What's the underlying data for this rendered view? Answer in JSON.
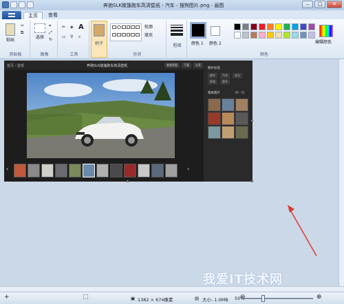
{
  "window": {
    "title": "奔驰SLK敞篷跑车高清壁纸 - 汽车 - 搜狗图片.png - 画图",
    "min_label": "–",
    "max_label": "□",
    "close_label": "✕"
  },
  "tabs": [
    {
      "label": "主页"
    },
    {
      "label": "查看"
    }
  ],
  "ribbon": {
    "clipboard": {
      "label": "剪贴板",
      "paste": "粘贴"
    },
    "image": {
      "label": "图像",
      "select": "选择"
    },
    "tools": {
      "label": "工具",
      "text_tool": "A"
    },
    "brushes": {
      "label": "刷子"
    },
    "shapes": {
      "label": "形状",
      "outline": "轮廓",
      "fill": "填充"
    },
    "size": {
      "label": "粗细"
    },
    "colors": {
      "label": "颜色",
      "color1": "颜色 1",
      "color2": "颜色 2",
      "edit": "编辑颜色",
      "palette": [
        "#000000",
        "#7f7f7f",
        "#880015",
        "#ed1c24",
        "#ff7f27",
        "#fff200",
        "#22b14c",
        "#00a2e8",
        "#3f48cc",
        "#a349a4",
        "#ffffff",
        "#c3c3c3",
        "#b97a57",
        "#ffaec9",
        "#ffc90e",
        "#efe4b0",
        "#b5e61d",
        "#99d9ea",
        "#7092be",
        "#c8bfe7"
      ]
    }
  },
  "screenshot": {
    "breadcrumb": "首页 › 壁纸",
    "title": "奔驰SLK敞篷跑车高清壁纸",
    "tools": [
      "查看原图",
      "下载",
      "分享"
    ],
    "side": {
      "sec1": "图片标签",
      "chips": [
        "跑车",
        "汽车",
        "宝马",
        "奔驰",
        "赛车"
      ],
      "sec2": "相关图片",
      "more": "换一批"
    }
  },
  "status": {
    "dimensions": "1382 × 674像素",
    "filesize": "大小: 1.0MB",
    "zoom": "50%"
  },
  "watermark": "我爱IT技术网"
}
